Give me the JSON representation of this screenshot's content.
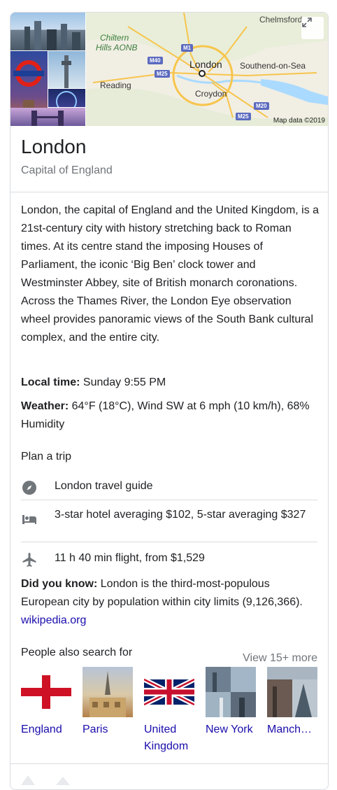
{
  "map": {
    "labels": [
      "Chelmsford",
      "Chiltern",
      "Hills AONB",
      "London",
      "Southend-on-Sea",
      "Reading",
      "Croydon"
    ],
    "roads": [
      "M1",
      "M40",
      "M25",
      "M20",
      "M25"
    ],
    "attribution": "Map data ©2019"
  },
  "entity": {
    "title": "London",
    "subtitle": "Capital of England"
  },
  "description": "London, the capital of England and the United Kingdom, is a 21st-century city with history stretching back to Roman times. At its centre stand the imposing Houses of Parliament, the iconic ‘Big Ben’ clock tower and Westminster Abbey, site of British monarch coronations. Across the Thames River, the London Eye observation wheel provides panoramic views of the South Bank cultural complex, and the entire city.",
  "facts": {
    "local_time_label": "Local time:",
    "local_time_value": " Sunday 9:55 PM",
    "weather_label": "Weather:",
    "weather_value": " 64°F (18°C), Wind SW at 6 mph (10 km/h), 68% Humidity"
  },
  "plan": {
    "title": "Plan a trip",
    "items": [
      {
        "icon": "compass-icon",
        "text": "London travel guide"
      },
      {
        "icon": "hotel-bed-icon",
        "text": "3-star hotel averaging $102, 5-star averaging $327"
      },
      {
        "icon": "airplane-icon",
        "text": "11 h 40 min flight, from $1,529"
      }
    ]
  },
  "did_you_know": {
    "label": "Did you know:",
    "text": " London is the third-most-populous European city by population within city limits (9,126,366). ",
    "link": "wikipedia.org"
  },
  "pasf": {
    "title": "People also search for",
    "more": "View 15+ more",
    "items": [
      {
        "label": "England"
      },
      {
        "label": "Paris"
      },
      {
        "label": "United Kingdom"
      },
      {
        "label": "New York"
      },
      {
        "label": "Manch…"
      }
    ]
  },
  "colors": {
    "link": "#1a0dab",
    "secondary_text": "#70757a",
    "divider": "#dadce0"
  }
}
